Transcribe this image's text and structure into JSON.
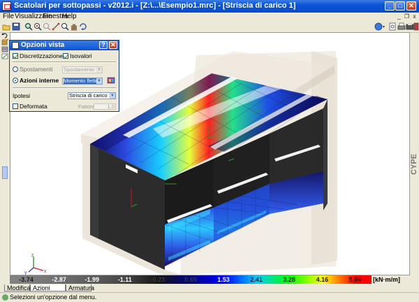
{
  "window": {
    "title": "Scatolari per sottopassi - v2012.i - [Z:\\...\\Esempio1.mrc] - [Striscia di carico 1]",
    "buttons": {
      "minimize": "_",
      "maximize": "□",
      "close": "✕"
    }
  },
  "menu": {
    "items": [
      "File",
      "Visualizzare",
      "Finestra",
      "Help"
    ],
    "child_controls": {
      "minimize": "_",
      "restore": "❐",
      "close": "x"
    }
  },
  "toolbar": {
    "left_tools": [
      "open-icon",
      "save-icon",
      "zoom-window-icon",
      "zoom-all-icon",
      "zoom-previous-icon",
      "measure-icon",
      "zoom-icon",
      "pan-icon",
      "rotate-icon"
    ],
    "right_tools": [
      "help-icon",
      "print-preview-icon",
      "print-icon",
      "settings-icon",
      "exit-icon"
    ]
  },
  "dialog": {
    "title": "Opzioni vista",
    "help_btn": "?",
    "close_btn": "✕",
    "discretizzazione": {
      "label": "Discretizzazione",
      "checked": true
    },
    "isovalori": {
      "label": "Isovalori",
      "checked": true
    },
    "spostamenti": {
      "label": "Spostamenti",
      "value": "Spostamento X",
      "selected": false
    },
    "azioni_interne": {
      "label": "Azioni interne",
      "value": "Momento flettente Y",
      "selected": true
    },
    "ipotesi": {
      "label": "Ipotesi",
      "value": "Striscia di carico 1"
    },
    "deformata": {
      "label": "Deformata",
      "checked": false
    },
    "fattore": {
      "label": "Fattore",
      "value": "1.0"
    }
  },
  "scale": {
    "labels": [
      "-3.74",
      "-2.87",
      "-1.99",
      "-1.11",
      "-0.23",
      "0.65",
      "1.53",
      "2.41",
      "3.28",
      "4.16",
      "5.04"
    ],
    "unit": "[kN·m/m]",
    "colors": [
      "#808080",
      "#6f6f6f",
      "#5c5c5c",
      "#474747",
      "#151515",
      "#000080",
      "#0000ff",
      "#00ccff",
      "#00ff00",
      "#ffff00",
      "#ff0000"
    ]
  },
  "tabs": [
    "Modifica",
    "Azioni interne",
    "Armatura"
  ],
  "active_tab": "Azioni interne",
  "brand": "CYPE",
  "status_text": "Selezioni un'opzione dal menu."
}
